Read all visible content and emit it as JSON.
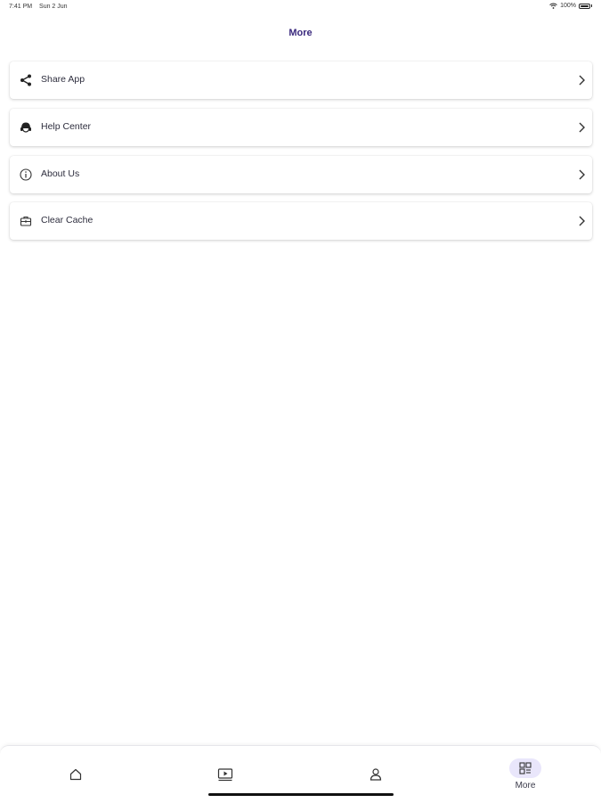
{
  "status_bar": {
    "time": "7:41 PM",
    "date": "Sun 2 Jun",
    "battery": "100%"
  },
  "header": {
    "title": "More"
  },
  "menu": {
    "items": [
      {
        "label": "Share App",
        "icon": "share-icon"
      },
      {
        "label": "Help Center",
        "icon": "headset-icon"
      },
      {
        "label": "About Us",
        "icon": "info-icon"
      },
      {
        "label": "Clear Cache",
        "icon": "cache-briefcase-icon"
      }
    ]
  },
  "tab_bar": {
    "tabs": [
      {
        "icon": "home-icon",
        "label": ""
      },
      {
        "icon": "video-icon",
        "label": ""
      },
      {
        "icon": "profile-icon",
        "label": ""
      },
      {
        "icon": "grid-icon",
        "label": "More",
        "active": true
      }
    ],
    "active_color": "#e9e6fb"
  },
  "colors": {
    "accent": "#3b2a7e"
  }
}
